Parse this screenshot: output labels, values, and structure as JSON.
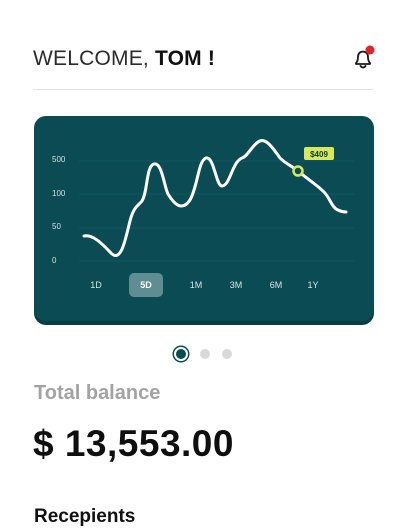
{
  "header": {
    "greeting": "WELCOME,",
    "name": "TOM !"
  },
  "chart": {
    "y_ticks": [
      "500",
      "100",
      "50",
      "0"
    ],
    "marker_label": "$409",
    "ranges": [
      "1D",
      "5D",
      "1M",
      "3M",
      "6M",
      "1Y"
    ],
    "active_range": "5D"
  },
  "carousel": {
    "pages": 3,
    "active_index": 0
  },
  "balance": {
    "label": "Total balance",
    "value": "$ 13,553.00"
  },
  "recipients": {
    "title": "Recepients"
  },
  "colors": {
    "card": "#0b4b53",
    "line": "#ffffff",
    "marker": "#d7e85a",
    "notification": "#e02424"
  },
  "icons": {
    "bell": "bell-icon",
    "notification_dot": "notification-dot"
  }
}
